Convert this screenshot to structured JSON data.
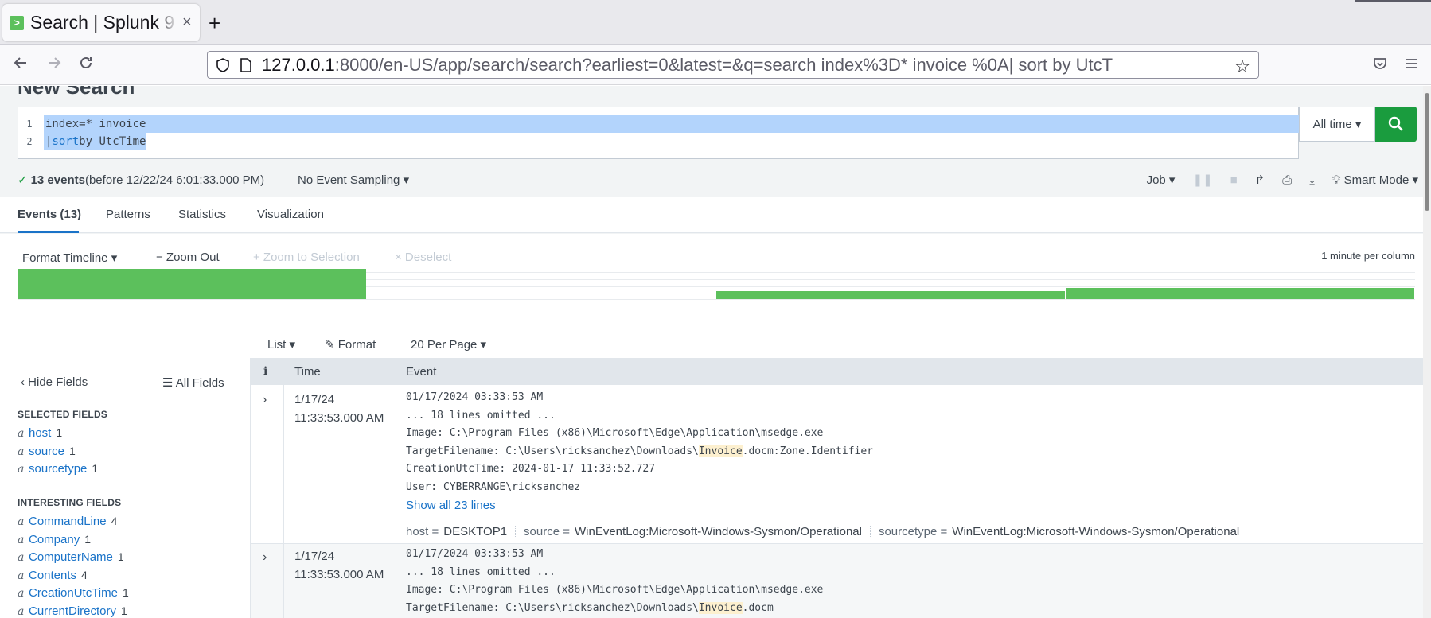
{
  "browser": {
    "tab_title": "Search | Splunk 9",
    "favicon": ">",
    "close": "×",
    "new_tab": "+",
    "url_host": "127.0.0.1",
    "url_rest": ":8000/en-US/app/search/search?earliest=0&latest=&q=search index%3D* invoice %0A| sort by UtcT"
  },
  "page": {
    "title": "New Search",
    "query_line1": "index=* invoice",
    "query_line2_pipe": "| ",
    "query_line2_kw": "sort",
    "query_line2_rest": " by UtcTime",
    "line1_no": "1",
    "line2_no": "2",
    "time_range": "All time ▾",
    "status_count": "13 events",
    "status_rest": " (before 12/22/24 6:01:33.000 PM)",
    "sampling": "No Event Sampling ▾",
    "job": "Job ▾",
    "smart_mode": "Smart Mode ▾"
  },
  "tabs": [
    "Events (13)",
    "Patterns",
    "Statistics",
    "Visualization"
  ],
  "timeline": {
    "format": "Format Timeline ▾",
    "zoom_out": "− Zoom Out",
    "zoom_sel": "+ Zoom to Selection",
    "deselect": "× Deselect",
    "scale": "1 minute per column",
    "bars": [
      {
        "count": 8
      },
      {
        "count": 0
      },
      {
        "count": 2
      },
      {
        "count": 3
      }
    ]
  },
  "list_controls": {
    "list": "List ▾",
    "format": "Format",
    "per_page": "20 Per Page ▾"
  },
  "fields": {
    "hide": "Hide Fields",
    "all": "All Fields",
    "selected_heading": "SELECTED FIELDS",
    "interesting_heading": "INTERESTING FIELDS",
    "selected": [
      {
        "name": "host",
        "count": "1"
      },
      {
        "name": "source",
        "count": "1"
      },
      {
        "name": "sourcetype",
        "count": "1"
      }
    ],
    "interesting": [
      {
        "name": "CommandLine",
        "count": "4"
      },
      {
        "name": "Company",
        "count": "1"
      },
      {
        "name": "ComputerName",
        "count": "1"
      },
      {
        "name": "Contents",
        "count": "4"
      },
      {
        "name": "CreationUtcTime",
        "count": "1"
      },
      {
        "name": "CurrentDirectory",
        "count": "1"
      }
    ]
  },
  "results": {
    "col_i": "i",
    "col_time": "Time",
    "col_event": "Event",
    "events": [
      {
        "date": "1/17/24",
        "time": "11:33:53.000 AM",
        "line1": "01/17/2024 03:33:53 AM",
        "line2": "... 18 lines omitted ...",
        "line3": "Image: C:\\Program Files (x86)\\Microsoft\\Edge\\Application\\msedge.exe",
        "line4_pre": "TargetFilename: C:\\Users\\ricksanchez\\Downloads\\",
        "line4_hl": "Invoice",
        "line4_post": ".docm:Zone.Identifier",
        "line5": "CreationUtcTime: 2024-01-17 11:33:52.727",
        "line6": "User: CYBERRANGE\\ricksanchez",
        "show_all": "Show all 23 lines",
        "host": "DESKTOP1",
        "source": "WinEventLog:Microsoft-Windows-Sysmon/Operational",
        "sourcetype": "WinEventLog:Microsoft-Windows-Sysmon/Operational"
      },
      {
        "date": "1/17/24",
        "time": "11:33:53.000 AM",
        "line1": "01/17/2024 03:33:53 AM",
        "line2": "... 18 lines omitted ...",
        "line3": "Image: C:\\Program Files (x86)\\Microsoft\\Edge\\Application\\msedge.exe",
        "line4_pre": "TargetFilename: C:\\Users\\ricksanchez\\Downloads\\",
        "line4_hl": "Invoice",
        "line4_post": ".docm"
      }
    ],
    "meta_labels": {
      "host": "host =",
      "source": "source =",
      "sourcetype": "sourcetype ="
    }
  }
}
